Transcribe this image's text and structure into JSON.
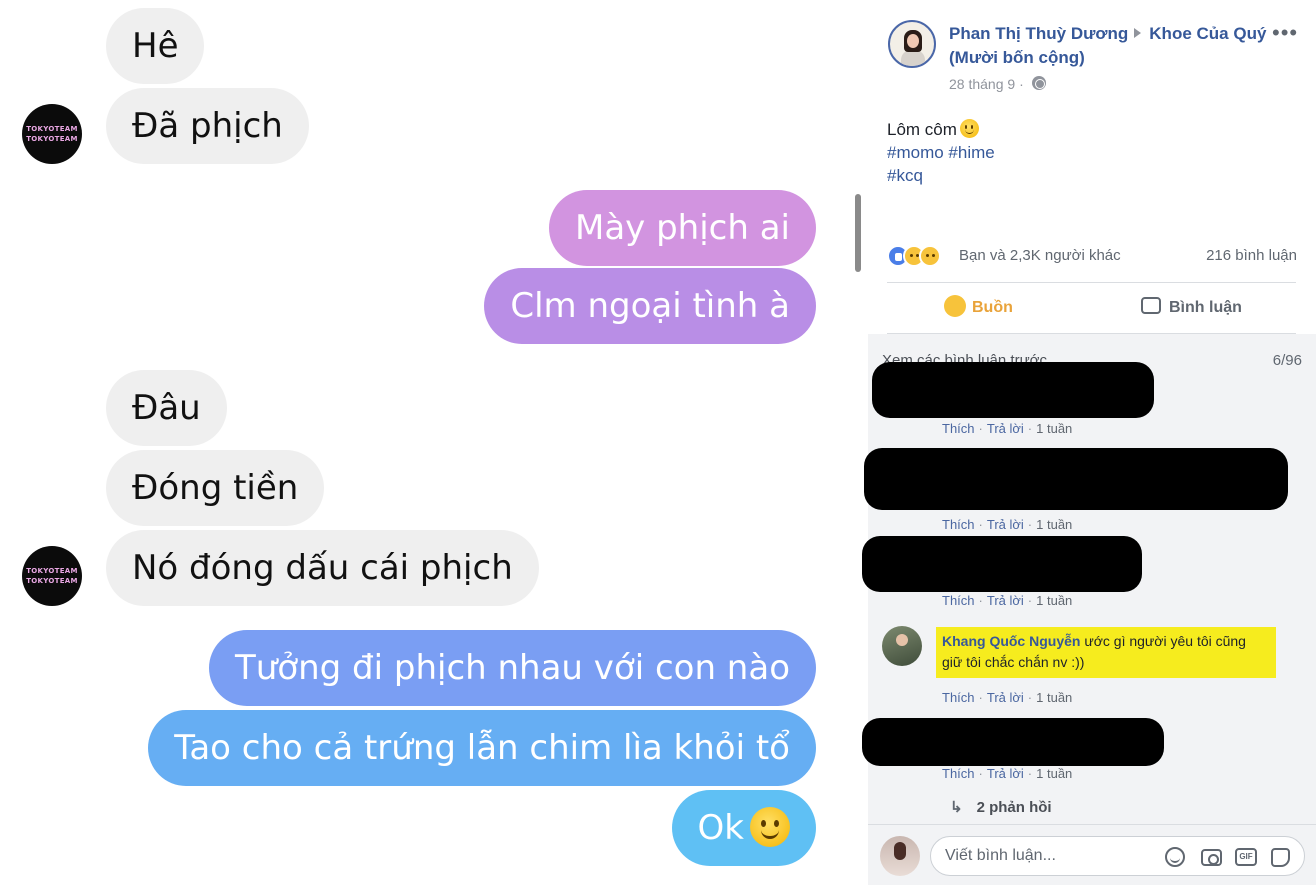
{
  "chat": {
    "messages": [
      {
        "side": "in",
        "text": "Hê"
      },
      {
        "side": "in",
        "text": "Đã phịch"
      },
      {
        "side": "out",
        "text": "Mày phịch ai"
      },
      {
        "side": "out",
        "text": "Clm ngoại tình à"
      },
      {
        "side": "in",
        "text": "Đâu"
      },
      {
        "side": "in",
        "text": "Đóng tiền"
      },
      {
        "side": "in",
        "text": "Nó đóng dấu cái phịch"
      },
      {
        "side": "out",
        "text": "Tưởng đi phịch nhau với con nào"
      },
      {
        "side": "out",
        "text": "Tao cho cả trứng lẫn chim lìa khỏi tổ"
      },
      {
        "side": "out",
        "text": "Ok"
      }
    ],
    "avatar_text_1": "TOKYOTEAM",
    "avatar_text_2": "TOKYOTEAM",
    "colors": {
      "incoming": "#efefef",
      "purple": "#c58ee2",
      "blue": "#62a7f2"
    }
  },
  "post": {
    "author": "Phan Thị Thuỳ Dương",
    "group": "Khoe Của Quý (Mười bốn cộng)",
    "date": "28 tháng 9",
    "more": "•••",
    "text_line1": "Lôm côm",
    "hashtags_line1": "#momo #hime",
    "hashtags_line2": "#kcq",
    "reactions_text": "Bạn và 2,3K người khác",
    "comments_count": "216 bình luận",
    "actions": {
      "sad": "Buồn",
      "comment": "Bình luận"
    }
  },
  "comments": {
    "view_previous": "Xem các bình luận trước",
    "position": "6/96",
    "like_label": "Thích",
    "reply_label": "Trả lời",
    "time_label": "1 tuần",
    "highlight_author": "Khang Quốc Nguyễn",
    "highlight_text": "ước gì người yêu tôi cũng giữ tôi chắc chắn nv :))",
    "replies_label": "2 phản hồi",
    "composer_placeholder": "Viết bình luận..."
  }
}
